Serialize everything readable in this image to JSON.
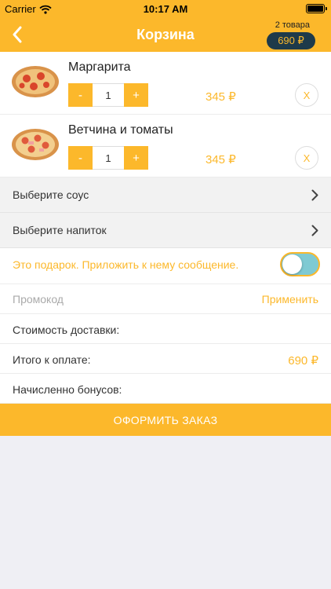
{
  "status_bar": {
    "carrier": "Carrier",
    "time": "10:17 AM"
  },
  "header": {
    "title": "Корзина",
    "item_count": "2 товара",
    "total": "690 ₽"
  },
  "cart_items": [
    {
      "name": "Маргарита",
      "quantity": "1",
      "price": "345 ₽",
      "minus": "-",
      "plus": "+",
      "remove": "X"
    },
    {
      "name": "Ветчина и томаты",
      "quantity": "1",
      "price": "345 ₽",
      "minus": "-",
      "plus": "+",
      "remove": "X"
    }
  ],
  "options": {
    "sauce_label": "Выберите соус",
    "drink_label": "Выберите напиток"
  },
  "gift": {
    "label": "Это подарок. Приложить к нему сообщение.",
    "toggle_on": false
  },
  "promo": {
    "placeholder": "Промокод",
    "value": "",
    "apply_label": "Применить"
  },
  "summary": {
    "delivery_label": "Стоимость доставки:",
    "delivery_value": "",
    "total_label": "Итого к оплате:",
    "total_value": "690 ₽",
    "bonus_label": "Начисленно бонусов:",
    "bonus_value": ""
  },
  "checkout": {
    "label": "ОФОРМИТЬ ЗАКАЗ"
  },
  "colors": {
    "accent": "#fcb82b",
    "badge_bg": "#1e3a4a",
    "toggle_fill": "#7fcad3",
    "background": "#efeff4"
  },
  "icons": [
    "wifi-icon",
    "battery-icon",
    "back-chevron-icon",
    "chevron-right-icon",
    "pizza-image"
  ]
}
